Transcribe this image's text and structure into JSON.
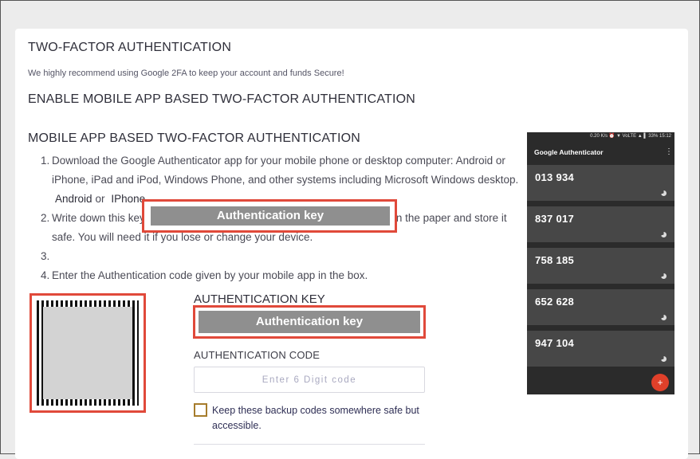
{
  "page": {
    "title": "TWO-FACTOR AUTHENTICATION",
    "subtitle": "We highly recommend using Google 2FA to keep your account and funds Secure!",
    "enable_heading": "ENABLE MOBILE APP BASED TWO-FACTOR AUTHENTICATION",
    "mobile_heading": "MOBILE APP BASED TWO-FACTOR AUTHENTICATION"
  },
  "steps": {
    "step1_num": "1.",
    "step1_text": "Download the Google Authenticator app for your mobile phone or desktop computer: Android or iPhone, iPad and iPod, Windows Phone, and other systems including Microsoft Windows desktop.",
    "android_link": "Android",
    "or_text": "or",
    "iphone_link": "IPhone",
    "step2_num": "2.",
    "step2_prefix": "Write down this key",
    "step2_suffix": "on the paper and store it safe. You will need it if you lose or change your device.",
    "step3_num": "3.",
    "step4_num": "4.",
    "step4_text": "Enter the Authentication code given by your mobile app in the box."
  },
  "inline_key": {
    "label": "Authentication key"
  },
  "auth_key": {
    "heading": "AUTHENTICATION KEY",
    "value": "Authentication key"
  },
  "auth_code": {
    "heading": "AUTHENTICATION CODE",
    "placeholder": "Enter 6 Digit code"
  },
  "backup": {
    "label": "Keep these backup codes somewhere safe but accessible."
  },
  "phone": {
    "status": "0.20 K/s  ⏰ ▼ VoLTE ▲ ▌ 33%  15:12",
    "app_title": "Google Authenticator",
    "codes": [
      "013 934",
      "837 017",
      "758 185",
      "652 628",
      "947 104"
    ],
    "fab_label": "+"
  },
  "colors": {
    "highlight_border": "#e0493a",
    "key_fill": "#8f8f8f",
    "phone_bg": "#2b2b2b",
    "card_bg": "#474747",
    "fab": "#e0402a"
  }
}
